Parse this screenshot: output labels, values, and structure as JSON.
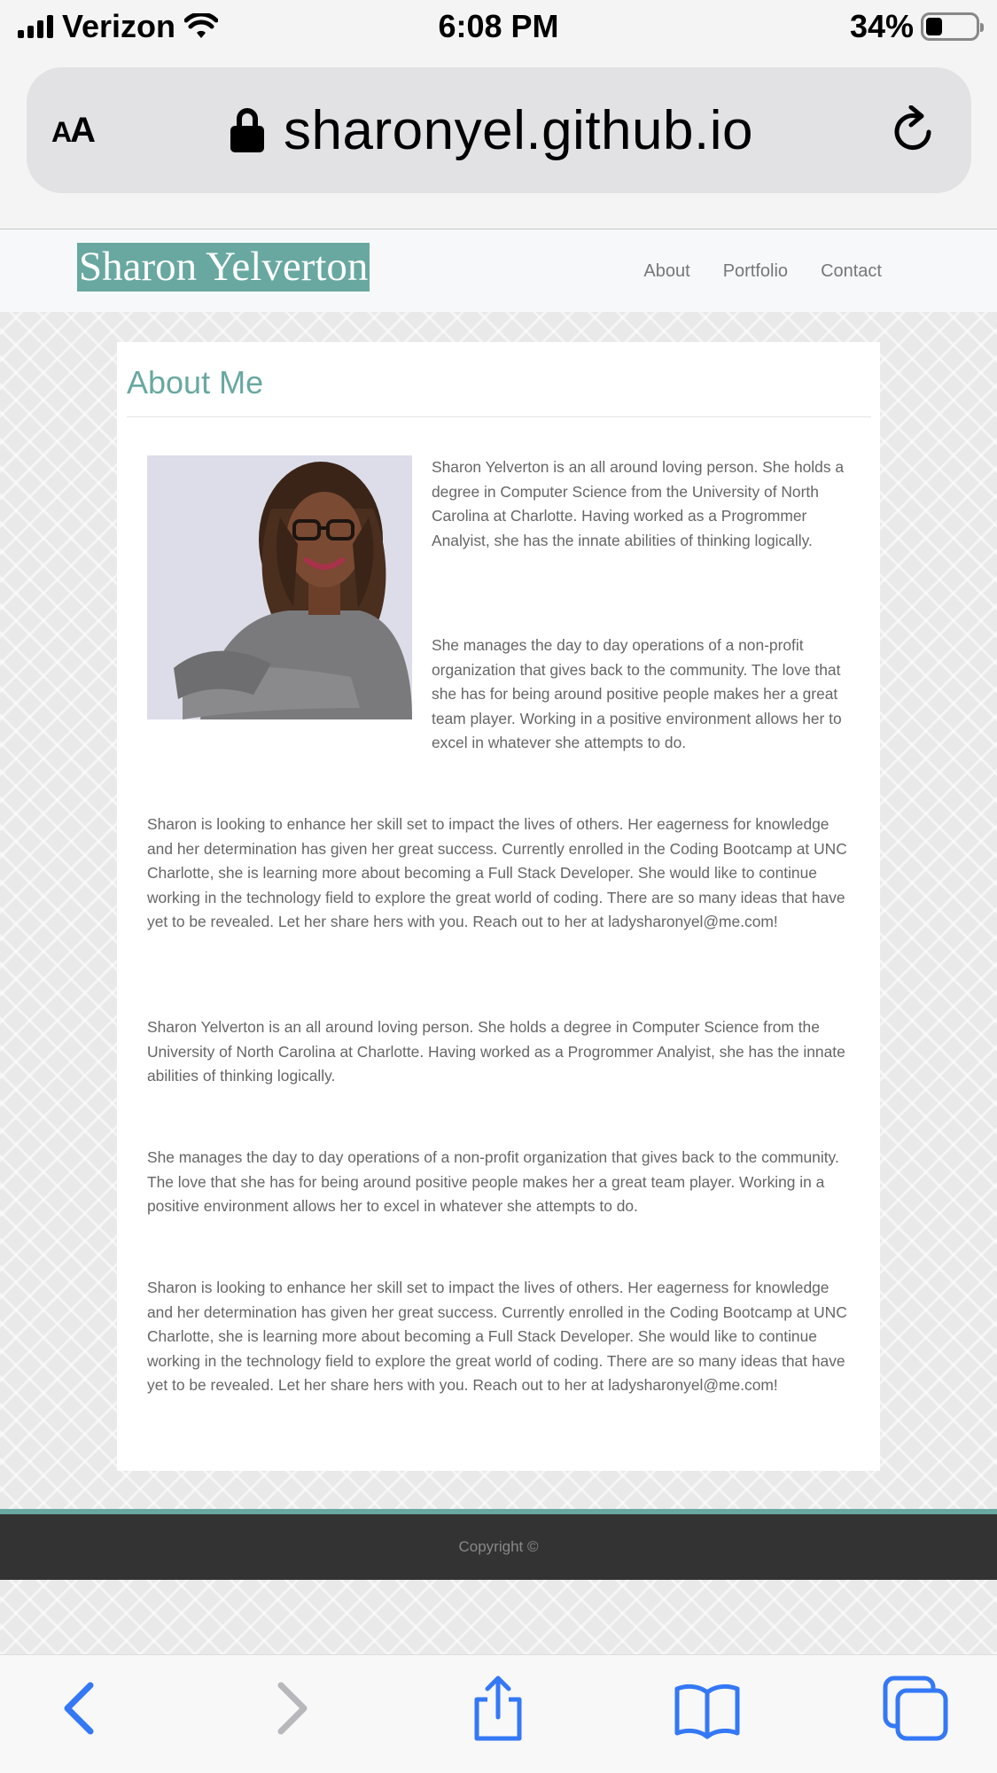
{
  "status_bar": {
    "carrier": "Verizon",
    "time": "6:08 PM",
    "battery_text": "34%",
    "battery_level": 0.34
  },
  "browser": {
    "aa_label_small": "A",
    "aa_label_large": "A",
    "url": "sharonyel.github.io"
  },
  "site": {
    "brand": "Sharon Yelverton",
    "nav": [
      "About",
      "Portfolio",
      "Contact"
    ],
    "accent_color": "#68a8a0"
  },
  "content": {
    "title": "About Me",
    "paragraphs": [
      "Sharon Yelverton is an all around loving person. She holds a degree in Computer Science from the University of North Carolina at Charlotte. Having worked as a Progrommer Analyist, she has the innate abilities of thinking logically.",
      "She manages the day to day operations of a non-profit organization that gives back to the community. The love that she has for being around positive people makes her a great team player. Working in a positive environment allows her to excel in whatever she attempts to do.",
      "Sharon is looking to enhance her skill set to impact the lives of others. Her eagerness for knowledge and her determination has given her great success. Currently enrolled in the Coding Bootcamp at UNC Charlotte, she is learning more about becoming a Full Stack Developer. She would like to continue working in the technology field to explore the great world of coding. There are so many ideas that have yet to be revealed. Let her share hers with you. Reach out to her at ladysharonyel@me.com!",
      "Sharon Yelverton is an all around loving person. She holds a degree in Computer Science from the University of North Carolina at Charlotte. Having worked as a Progrommer Analyist, she has the innate abilities of thinking logically.",
      "She manages the day to day operations of a non-profit organization that gives back to the community. The love that she has for being around positive people makes her a great team player. Working in a positive environment allows her to excel in whatever she attempts to do.",
      "Sharon is looking to enhance her skill set to impact the lives of others. Her eagerness for knowledge and her determination has given her great success. Currently enrolled in the Coding Bootcamp at UNC Charlotte, she is learning more about becoming a Full Stack Developer. She would like to continue working in the technology field to explore the great world of coding. There are so many ideas that have yet to be revealed. Let her share hers with you. Reach out to her at ladysharonyel@me.com!"
    ]
  },
  "footer": {
    "copyright": "Copyright ©"
  },
  "toolbar": {
    "icons": [
      "back-icon",
      "forward-icon",
      "share-icon",
      "bookmarks-icon",
      "tabs-icon"
    ],
    "icon_color": "#3478f6",
    "disabled_color": "#b8b8bc"
  }
}
